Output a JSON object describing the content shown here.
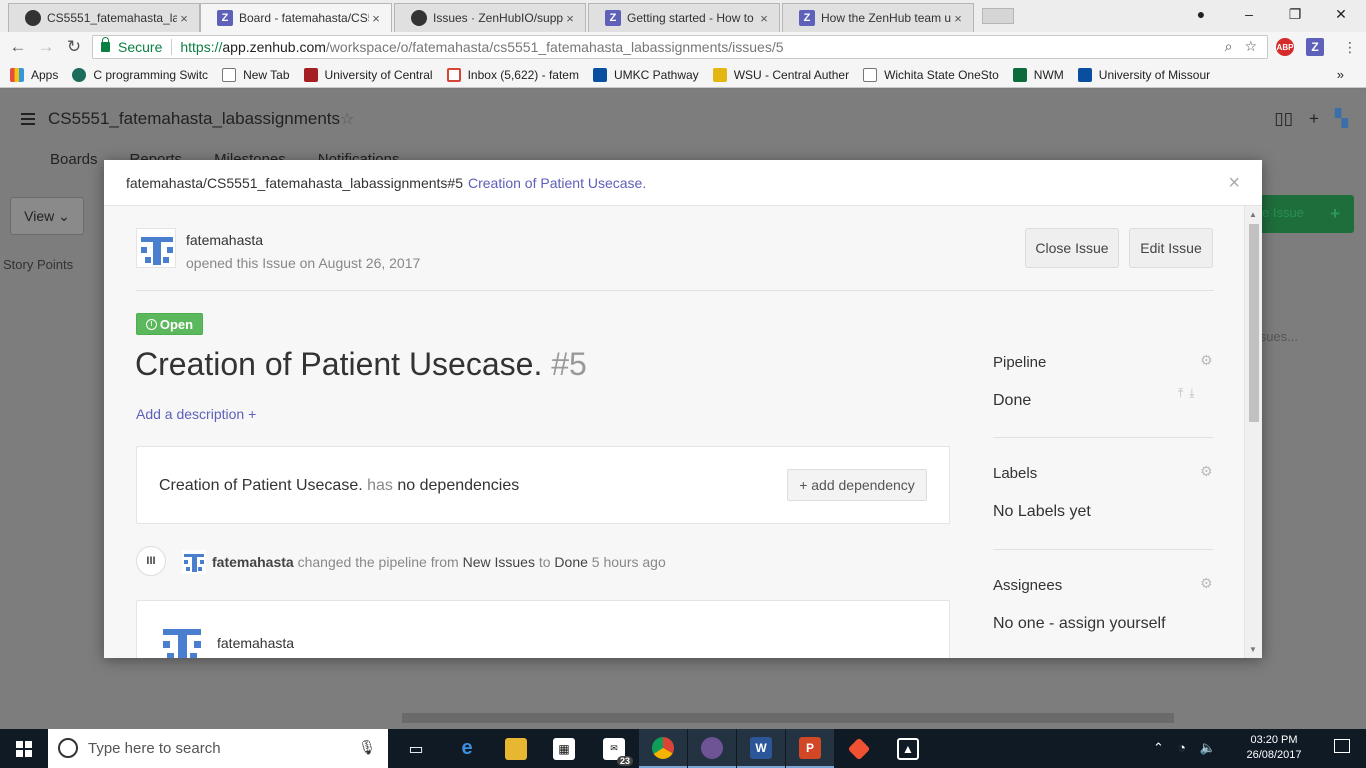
{
  "browser": {
    "tabs": [
      {
        "icon": "github",
        "label": "CS5551_fatemahasta_lab"
      },
      {
        "icon": "zenhub",
        "label": "Board - fatemahasta/CS5"
      },
      {
        "icon": "github",
        "label": "Issues · ZenHubIO/suppo"
      },
      {
        "icon": "zenhub",
        "label": "Getting started - How to"
      },
      {
        "icon": "zenhub",
        "label": "How the ZenHub team u"
      }
    ],
    "tab_close": "×",
    "secure_label": "Secure",
    "url_scheme": "https://",
    "url_host": "app.zenhub.com",
    "url_path": "/workspace/o/fatemahasta/cs5551_fatemahasta_labassignments/issues/5",
    "ext_abp": "ABP",
    "ext_z": "Z",
    "bookmarks": [
      "Apps",
      "C programming Switc",
      "New Tab",
      "University of Central",
      "Inbox (5,622) - fatem",
      "UMKC Pathway",
      "WSU - Central Auther",
      "Wichita State OneSto",
      "NWM",
      "University of Missour"
    ],
    "bookmarks_more": "»"
  },
  "workspace": {
    "title": "CS5551_fatemahasta_labassignments",
    "tabs": [
      "Boards",
      "Reports",
      "Milestones",
      "Notifications"
    ],
    "view_label": "View",
    "story_points": "Story Points",
    "new_issue_partial": "e Issue",
    "new_issue_plus": "+",
    "issues_hint": "sues..."
  },
  "modal": {
    "breadcrumb": "fatemahasta/CS5551_fatemahasta_labassignments#5",
    "title_link": "Creation of Patient Usecase.",
    "close": "×",
    "author": "fatemahasta",
    "opened_text": "opened this Issue on August 26, 2017",
    "close_issue": "Close Issue",
    "edit_issue": "Edit Issue",
    "status": "Open",
    "issue_title": "Creation of Patient Usecase.",
    "issue_number": "#5",
    "add_description": "Add a description +",
    "dependency": {
      "title": "Creation of Patient Usecase.",
      "has": "has",
      "none": "no dependencies",
      "add_button": "+ add dependency"
    },
    "event": {
      "icon_text": "III",
      "user": "fatemahasta",
      "changed": "changed the pipeline from",
      "from": "New Issues",
      "to_word": "to",
      "to": "Done",
      "when": "5 hours ago"
    },
    "comment_author": "fatemahasta",
    "sidebar": {
      "pipeline_label": "Pipeline",
      "pipeline_value": "Done",
      "labels_label": "Labels",
      "labels_value": "No Labels yet",
      "assignees_label": "Assignees",
      "assignees_value": "No one - assign yourself"
    }
  },
  "taskbar": {
    "search_placeholder": "Type here to search",
    "mail_badge": "23",
    "time": "03:20 PM",
    "date": "26/08/2017"
  },
  "colors": {
    "accent": "#5e60ba",
    "open_green": "#5cb85c",
    "secure_green": "#0b8043"
  }
}
